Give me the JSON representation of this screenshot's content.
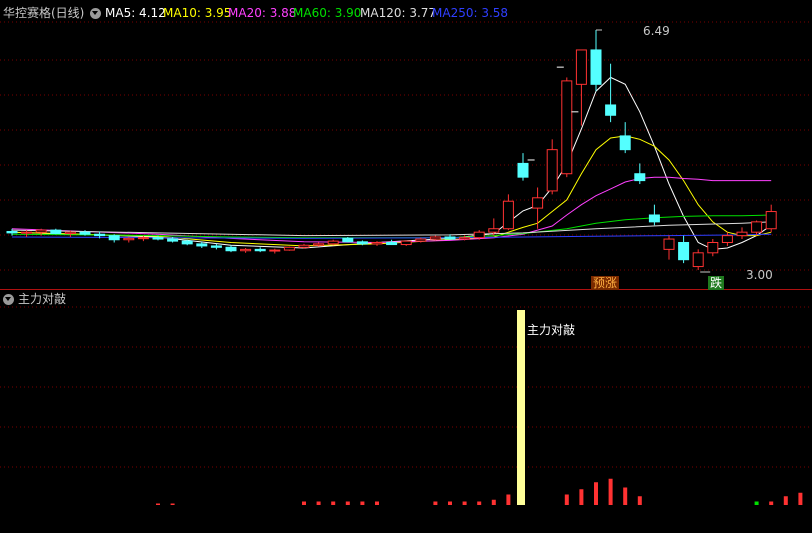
{
  "header": {
    "title": "华控赛格(日线)",
    "ma": [
      {
        "label": "MA5: 4.12",
        "color": "#ffffff"
      },
      {
        "label": "MA10: 3.95",
        "color": "#ffff00"
      },
      {
        "label": "MA20: 3.88",
        "color": "#ff40ff"
      },
      {
        "label": "MA60: 3.90",
        "color": "#00e000"
      },
      {
        "label": "MA120: 3.77",
        "color": "#dddddd"
      },
      {
        "label": "MA250: 3.58",
        "color": "#2f3fff"
      }
    ]
  },
  "main_chart": {
    "high_label": "6.49",
    "low_label": "3.00",
    "badge_rise": "预涨",
    "badge_fall": "跌"
  },
  "sub_chart": {
    "indicator_name": "主力对敲",
    "bar_label": "主力对敲"
  },
  "colors": {
    "up": "#ff3232",
    "down": "#54ffff",
    "grid": "#7a0000",
    "spike": "#ffff99"
  },
  "chart_data": {
    "type": "candlestick",
    "price_range": [
      2.7,
      6.8
    ],
    "candles": [
      {
        "o": 3.56,
        "h": 3.6,
        "l": 3.5,
        "c": 3.54
      },
      {
        "o": 3.54,
        "h": 3.58,
        "l": 3.48,
        "c": 3.55
      },
      {
        "o": 3.55,
        "h": 3.6,
        "l": 3.5,
        "c": 3.58
      },
      {
        "o": 3.58,
        "h": 3.6,
        "l": 3.52,
        "c": 3.53
      },
      {
        "o": 3.53,
        "h": 3.57,
        "l": 3.48,
        "c": 3.55
      },
      {
        "o": 3.55,
        "h": 3.58,
        "l": 3.5,
        "c": 3.52
      },
      {
        "o": 3.52,
        "h": 3.56,
        "l": 3.46,
        "c": 3.5
      },
      {
        "o": 3.5,
        "h": 3.52,
        "l": 3.4,
        "c": 3.44
      },
      {
        "o": 3.44,
        "h": 3.48,
        "l": 3.4,
        "c": 3.46
      },
      {
        "o": 3.46,
        "h": 3.5,
        "l": 3.42,
        "c": 3.47
      },
      {
        "o": 3.47,
        "h": 3.5,
        "l": 3.43,
        "c": 3.45
      },
      {
        "o": 3.45,
        "h": 3.48,
        "l": 3.4,
        "c": 3.42
      },
      {
        "o": 3.42,
        "h": 3.44,
        "l": 3.36,
        "c": 3.38
      },
      {
        "o": 3.38,
        "h": 3.41,
        "l": 3.32,
        "c": 3.35
      },
      {
        "o": 3.35,
        "h": 3.38,
        "l": 3.3,
        "c": 3.33
      },
      {
        "o": 3.33,
        "h": 3.36,
        "l": 3.26,
        "c": 3.28
      },
      {
        "o": 3.28,
        "h": 3.32,
        "l": 3.25,
        "c": 3.3
      },
      {
        "o": 3.3,
        "h": 3.33,
        "l": 3.26,
        "c": 3.28
      },
      {
        "o": 3.28,
        "h": 3.31,
        "l": 3.24,
        "c": 3.29
      },
      {
        "o": 3.29,
        "h": 3.34,
        "l": 3.28,
        "c": 3.33
      },
      {
        "o": 3.33,
        "h": 3.38,
        "l": 3.31,
        "c": 3.36
      },
      {
        "o": 3.36,
        "h": 3.4,
        "l": 3.34,
        "c": 3.38
      },
      {
        "o": 3.38,
        "h": 3.44,
        "l": 3.36,
        "c": 3.42
      },
      {
        "o": 3.46,
        "h": 3.48,
        "l": 3.4,
        "c": 3.41
      },
      {
        "o": 3.41,
        "h": 3.43,
        "l": 3.36,
        "c": 3.38
      },
      {
        "o": 3.38,
        "h": 3.42,
        "l": 3.35,
        "c": 3.4
      },
      {
        "o": 3.4,
        "h": 3.44,
        "l": 3.37,
        "c": 3.37
      },
      {
        "o": 3.37,
        "h": 3.43,
        "l": 3.35,
        "c": 3.42
      },
      {
        "o": 3.42,
        "h": 3.47,
        "l": 3.4,
        "c": 3.45
      },
      {
        "o": 3.45,
        "h": 3.5,
        "l": 3.43,
        "c": 3.48
      },
      {
        "o": 3.48,
        "h": 3.52,
        "l": 3.44,
        "c": 3.45
      },
      {
        "o": 3.45,
        "h": 3.5,
        "l": 3.43,
        "c": 3.47
      },
      {
        "o": 3.47,
        "h": 3.58,
        "l": 3.44,
        "c": 3.55
      },
      {
        "o": 3.55,
        "h": 3.75,
        "l": 3.5,
        "c": 3.6
      },
      {
        "o": 3.6,
        "h": 4.1,
        "l": 3.58,
        "c": 4.0
      },
      {
        "o": 4.55,
        "h": 4.7,
        "l": 4.3,
        "c": 4.35
      },
      {
        "o": 3.9,
        "h": 4.2,
        "l": 3.6,
        "c": 4.05
      },
      {
        "o": 4.15,
        "h": 4.9,
        "l": 4.1,
        "c": 4.75
      },
      {
        "o": 4.4,
        "h": 5.8,
        "l": 4.35,
        "c": 5.75
      },
      {
        "o": 5.7,
        "h": 6.2,
        "l": 5.1,
        "c": 6.2
      },
      {
        "o": 6.2,
        "h": 6.49,
        "l": 5.6,
        "c": 5.7
      },
      {
        "o": 5.4,
        "h": 6.0,
        "l": 5.15,
        "c": 5.25
      },
      {
        "o": 4.95,
        "h": 5.15,
        "l": 4.7,
        "c": 4.75
      },
      {
        "o": 4.4,
        "h": 4.55,
        "l": 4.25,
        "c": 4.3
      },
      {
        "o": 3.8,
        "h": 3.95,
        "l": 3.65,
        "c": 3.7
      },
      {
        "o": 3.3,
        "h": 3.5,
        "l": 3.15,
        "c": 3.45
      },
      {
        "o": 3.4,
        "h": 3.5,
        "l": 3.1,
        "c": 3.15
      },
      {
        "o": 3.05,
        "h": 3.3,
        "l": 3.0,
        "c": 3.25
      },
      {
        "o": 3.25,
        "h": 3.45,
        "l": 3.2,
        "c": 3.4
      },
      {
        "o": 3.4,
        "h": 3.55,
        "l": 3.35,
        "c": 3.5
      },
      {
        "o": 3.5,
        "h": 3.62,
        "l": 3.45,
        "c": 3.55
      },
      {
        "o": 3.55,
        "h": 3.72,
        "l": 3.5,
        "c": 3.7
      },
      {
        "o": 3.6,
        "h": 3.95,
        "l": 3.55,
        "c": 3.85
      }
    ],
    "ma_series": [
      {
        "name": "MA5",
        "color": "#ffffff",
        "values": [
          [
            0,
            3.55
          ],
          [
            10,
            3.48
          ],
          [
            15,
            3.36
          ],
          [
            20,
            3.32
          ],
          [
            25,
            3.4
          ],
          [
            30,
            3.46
          ],
          [
            33,
            3.53
          ],
          [
            35,
            3.86
          ],
          [
            36,
            3.94
          ],
          [
            37,
            4.2
          ],
          [
            38,
            4.54
          ],
          [
            39,
            5.05
          ],
          [
            40,
            5.6
          ],
          [
            41,
            5.8
          ],
          [
            42,
            5.7
          ],
          [
            43,
            5.3
          ],
          [
            44,
            4.8
          ],
          [
            45,
            4.25
          ],
          [
            46,
            3.78
          ],
          [
            47,
            3.4
          ],
          [
            48,
            3.3
          ],
          [
            49,
            3.32
          ],
          [
            50,
            3.4
          ],
          [
            51,
            3.5
          ],
          [
            52,
            3.65
          ]
        ]
      },
      {
        "name": "MA10",
        "color": "#ffff00",
        "values": [
          [
            0,
            3.55
          ],
          [
            10,
            3.49
          ],
          [
            15,
            3.4
          ],
          [
            20,
            3.35
          ],
          [
            25,
            3.38
          ],
          [
            30,
            3.44
          ],
          [
            33,
            3.48
          ],
          [
            35,
            3.62
          ],
          [
            36,
            3.68
          ],
          [
            37,
            3.85
          ],
          [
            38,
            4.02
          ],
          [
            39,
            4.4
          ],
          [
            40,
            4.75
          ],
          [
            41,
            4.92
          ],
          [
            42,
            4.95
          ],
          [
            43,
            4.9
          ],
          [
            44,
            4.8
          ],
          [
            45,
            4.6
          ],
          [
            46,
            4.3
          ],
          [
            47,
            3.95
          ],
          [
            48,
            3.7
          ],
          [
            49,
            3.55
          ],
          [
            50,
            3.5
          ],
          [
            51,
            3.5
          ],
          [
            52,
            3.55
          ]
        ]
      },
      {
        "name": "MA20",
        "color": "#ff40ff",
        "values": [
          [
            0,
            3.6
          ],
          [
            10,
            3.52
          ],
          [
            15,
            3.46
          ],
          [
            20,
            3.41
          ],
          [
            25,
            3.4
          ],
          [
            30,
            3.43
          ],
          [
            33,
            3.47
          ],
          [
            35,
            3.52
          ],
          [
            36,
            3.58
          ],
          [
            37,
            3.64
          ],
          [
            38,
            3.8
          ],
          [
            39,
            3.95
          ],
          [
            40,
            4.08
          ],
          [
            41,
            4.18
          ],
          [
            42,
            4.28
          ],
          [
            43,
            4.33
          ],
          [
            44,
            4.35
          ],
          [
            45,
            4.35
          ],
          [
            46,
            4.33
          ],
          [
            47,
            4.32
          ],
          [
            48,
            4.3
          ],
          [
            49,
            4.3
          ],
          [
            50,
            4.3
          ],
          [
            51,
            4.3
          ],
          [
            52,
            4.3
          ]
        ]
      },
      {
        "name": "MA60",
        "color": "#00e000",
        "values": [
          [
            0,
            3.52
          ],
          [
            10,
            3.5
          ],
          [
            15,
            3.48
          ],
          [
            20,
            3.47
          ],
          [
            25,
            3.47
          ],
          [
            30,
            3.47
          ],
          [
            33,
            3.5
          ],
          [
            35,
            3.53
          ],
          [
            38,
            3.6
          ],
          [
            40,
            3.68
          ],
          [
            42,
            3.73
          ],
          [
            44,
            3.76
          ],
          [
            46,
            3.78
          ],
          [
            48,
            3.79
          ],
          [
            50,
            3.79
          ],
          [
            52,
            3.8
          ]
        ]
      },
      {
        "name": "MA120",
        "color": "#dddddd",
        "values": [
          [
            0,
            3.58
          ],
          [
            10,
            3.54
          ],
          [
            20,
            3.5
          ],
          [
            30,
            3.51
          ],
          [
            35,
            3.54
          ],
          [
            40,
            3.6
          ],
          [
            45,
            3.65
          ],
          [
            50,
            3.68
          ],
          [
            52,
            3.7
          ]
        ]
      },
      {
        "name": "MA250",
        "color": "#2f3fff",
        "values": [
          [
            0,
            3.48
          ],
          [
            10,
            3.47
          ],
          [
            20,
            3.46
          ],
          [
            30,
            3.47
          ],
          [
            35,
            3.48
          ],
          [
            40,
            3.49
          ],
          [
            45,
            3.5
          ],
          [
            50,
            3.51
          ],
          [
            52,
            3.52
          ]
        ]
      }
    ],
    "sub_bars": [
      {
        "i": 10,
        "v": 0.3,
        "c": "#ff3232"
      },
      {
        "i": 11,
        "v": 0.3,
        "c": "#ff3232"
      },
      {
        "i": 20,
        "v": 1,
        "c": "#ff3232"
      },
      {
        "i": 21,
        "v": 1,
        "c": "#ff3232"
      },
      {
        "i": 22,
        "v": 1,
        "c": "#ff3232"
      },
      {
        "i": 23,
        "v": 1,
        "c": "#ff3232"
      },
      {
        "i": 24,
        "v": 1,
        "c": "#ff3232"
      },
      {
        "i": 25,
        "v": 1,
        "c": "#ff3232"
      },
      {
        "i": 29,
        "v": 1,
        "c": "#ff3232"
      },
      {
        "i": 30,
        "v": 1,
        "c": "#ff3232"
      },
      {
        "i": 31,
        "v": 1,
        "c": "#ff3232"
      },
      {
        "i": 32,
        "v": 1,
        "c": "#ff3232"
      },
      {
        "i": 33,
        "v": 1.5,
        "c": "#ff3232"
      },
      {
        "i": 34,
        "v": 3,
        "c": "#ff3232"
      },
      {
        "i": 38,
        "v": 3,
        "c": "#ff3232"
      },
      {
        "i": 39,
        "v": 4.5,
        "c": "#ff3232"
      },
      {
        "i": 40,
        "v": 6.5,
        "c": "#ff3232"
      },
      {
        "i": 41,
        "v": 7.5,
        "c": "#ff3232"
      },
      {
        "i": 42,
        "v": 5,
        "c": "#ff3232"
      },
      {
        "i": 43,
        "v": 2.5,
        "c": "#ff3232"
      },
      {
        "i": 51,
        "v": 1,
        "c": "#00e000"
      },
      {
        "i": 52,
        "v": 1,
        "c": "#ff3232"
      },
      {
        "i": 53,
        "v": 2.5,
        "c": "#ff3232"
      },
      {
        "i": 54,
        "v": 3.5,
        "c": "#ff3232"
      }
    ],
    "spike_index": 35
  }
}
